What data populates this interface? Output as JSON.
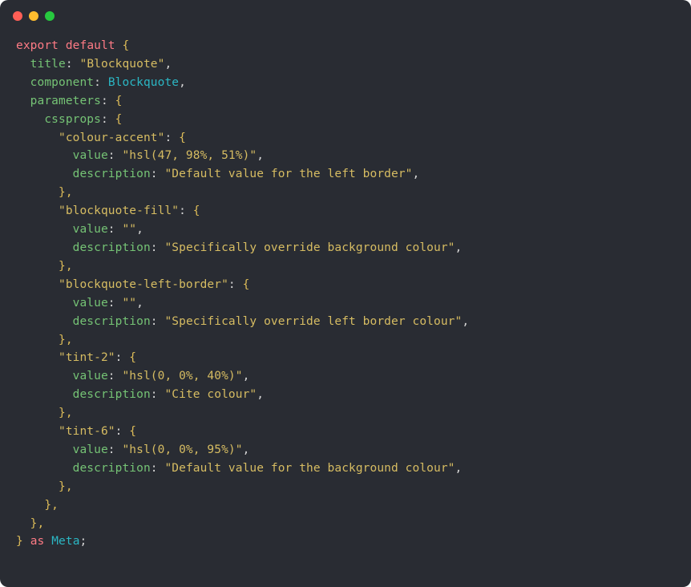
{
  "tokens": {
    "export": "export",
    "default": "default",
    "as": "as",
    "Meta": "Meta",
    "Blockquote": "Blockquote",
    "title": "title",
    "component": "component",
    "parameters": "parameters",
    "cssprops": "cssprops",
    "value": "value",
    "description": "description"
  },
  "strings": {
    "title_val": "\"Blockquote\"",
    "ca_key": "\"colour-accent\"",
    "ca_value": "\"hsl(47, 98%, 51%)\"",
    "ca_desc": "\"Default value for the left border\"",
    "bf_key": "\"blockquote-fill\"",
    "bf_value": "\"\"",
    "bf_desc": "\"Specifically override background colour\"",
    "blb_key": "\"blockquote-left-border\"",
    "blb_value": "\"\"",
    "blb_desc": "\"Specifically override left border colour\"",
    "t2_key": "\"tint-2\"",
    "t2_value": "\"hsl(0, 0%, 40%)\"",
    "t2_desc": "\"Cite colour\"",
    "t6_key": "\"tint-6\"",
    "t6_value": "\"hsl(0, 0%, 95%)\"",
    "t6_desc": "\"Default value for the background colour\""
  },
  "punct": {
    "colon_sp": ": ",
    "comma": ",",
    "obrace": "{",
    "cbrace": "}",
    "cbrace_comma": "},",
    "semicolon": ";",
    "space": " "
  }
}
